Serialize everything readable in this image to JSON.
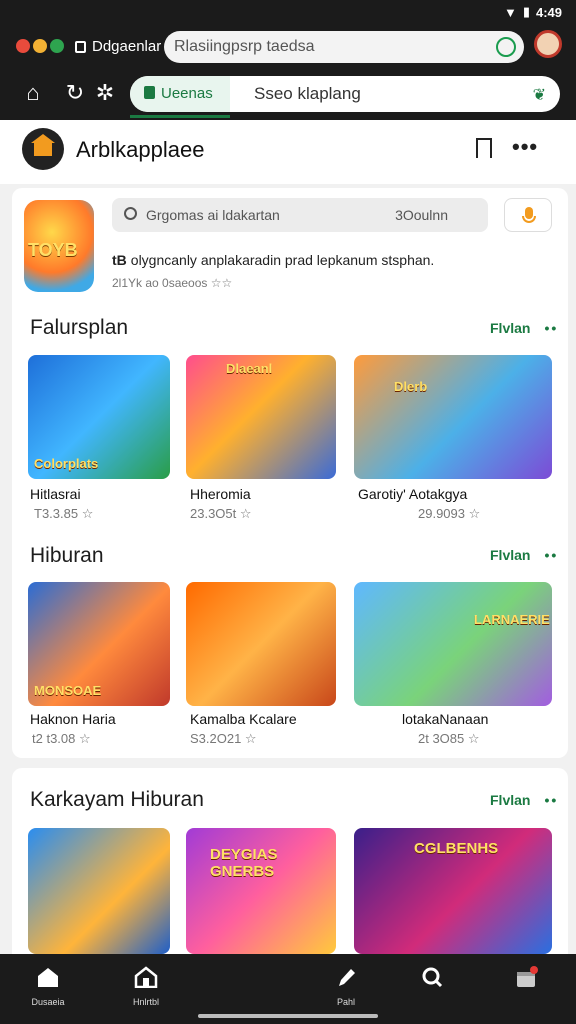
{
  "status": {
    "time": "4:49"
  },
  "browser": {
    "tab_title": "Ddgaenlar",
    "url": "Rlasiingpsrp taedsa",
    "secure_label": "Ueenas",
    "query": "Sseo klaplang"
  },
  "app": {
    "name": "Arblkapplaee"
  },
  "promo": {
    "icon_label": "TOYB",
    "search_placeholder": "Grgomas ai ldakartan",
    "search_count": "3Ooulnn",
    "headline_bold": "tB",
    "headline": "olygncanly anplakaradin prad lepkanum stsphan.",
    "meta": "2l1Yk ao 0saeoos ☆☆"
  },
  "sections": [
    {
      "title": "Falursplan",
      "more": "Flvlan",
      "games": [
        {
          "name": "Hitlasrai",
          "meta": "T3.3.85 ☆",
          "art": "Colorplats"
        },
        {
          "name": "Hheromia",
          "meta": "23.3O5t ☆",
          "art": "Dlaeanl"
        },
        {
          "name": "Garotiy' Aotakgya",
          "meta": "29.9093 ☆",
          "art": "Dlerb"
        }
      ]
    },
    {
      "title": "Hiburan",
      "more": "Flvlan",
      "games": [
        {
          "name": "Haknon Haria",
          "meta": "t2 t3.08 ☆",
          "art": "MONSOAE"
        },
        {
          "name": "Kamalba Kcalare",
          "meta": "S3.2O21 ☆",
          "art": ""
        },
        {
          "name": "lotakaNanaan",
          "meta": "2t 3O85 ☆",
          "art": "LARNAERIE"
        }
      ]
    },
    {
      "title": "Karkayam Hiburan",
      "more": "Flvlan",
      "games": [
        {
          "name": "",
          "meta": "",
          "art": ""
        },
        {
          "name": "",
          "meta": "",
          "art": "DEYGIAS GNERBS"
        },
        {
          "name": "",
          "meta": "",
          "art": "CGLBENHS"
        }
      ]
    }
  ],
  "bottom_nav": [
    {
      "label": "Dusaeia",
      "icon": "home-icon"
    },
    {
      "label": "Hnlrtbl",
      "icon": "store-icon"
    },
    {
      "label": "Pahl",
      "icon": "pen-icon"
    },
    {
      "label": "",
      "icon": "search-icon"
    },
    {
      "label": "",
      "icon": "library-icon"
    }
  ]
}
